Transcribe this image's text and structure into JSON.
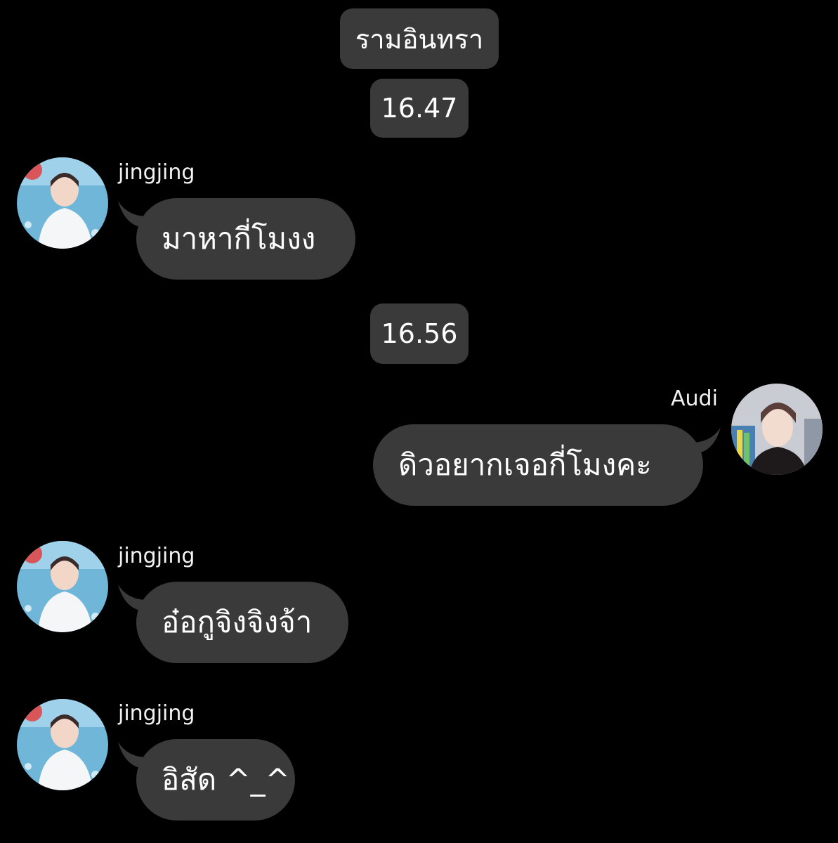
{
  "header": {
    "date_label": "รามอินทรา"
  },
  "timestamps": [
    "16.47",
    "16.56"
  ],
  "messages": [
    {
      "sender": "jingjing",
      "text": "มาหากี่โมงง",
      "side": "left"
    },
    {
      "sender": "Audi",
      "text": "ดิวอยากเจอกี่โมงคะ",
      "side": "right"
    },
    {
      "sender": "jingjing",
      "text": "อ๋อกูจิงจิงจ้า",
      "side": "left"
    },
    {
      "sender": "jingjing",
      "text": "อิสัด ^_^",
      "side": "left"
    }
  ],
  "colors": {
    "background": "#000000",
    "bubble": "#3a3a3a",
    "text": "#ffffff"
  }
}
